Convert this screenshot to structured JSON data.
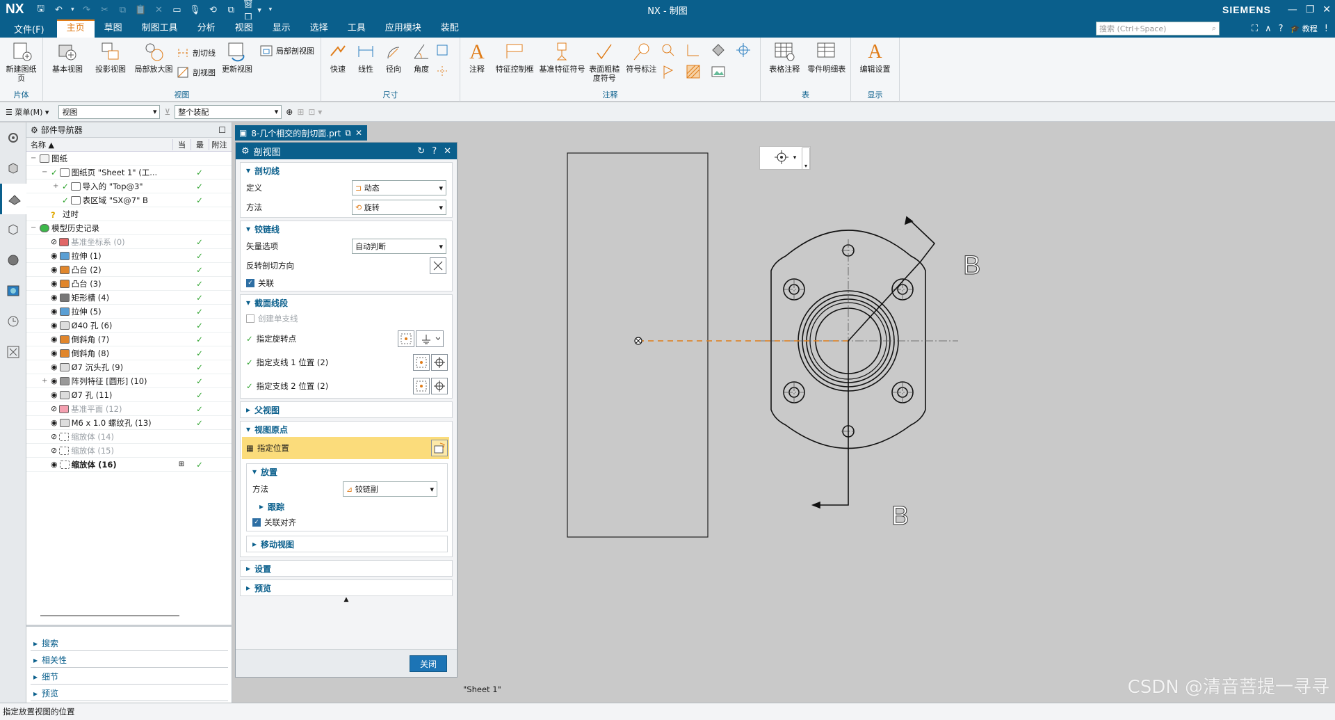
{
  "app": {
    "logo": "NX",
    "window_title": "NX - 制图",
    "brand": "SIEMENS",
    "window_menu": "窗口"
  },
  "menubar": {
    "file": "文件(F)",
    "tabs": [
      "主页",
      "草图",
      "制图工具",
      "分析",
      "视图",
      "显示",
      "选择",
      "工具",
      "应用模块",
      "装配"
    ],
    "active_tab": "主页",
    "search_placeholder": "搜索 (Ctrl+Space)",
    "help": "教程"
  },
  "ribbon": {
    "sheet_group": {
      "label": "片体",
      "new_sheet": "新建图纸页"
    },
    "view_group": {
      "label": "视图",
      "base_view": "基本视图",
      "projected_view": "投影视图",
      "detail_view": "局部放大图",
      "section_line": "剖切线",
      "section_view": "剖视图",
      "update_view": "更新视图",
      "break_out": "局部剖视图"
    },
    "dim_group": {
      "label": "尺寸",
      "rapid": "快速",
      "linear": "线性",
      "radial": "径向",
      "angular": "角度"
    },
    "annot_group": {
      "label": "注释",
      "note": "注释",
      "fcf": "特征控制框",
      "datum": "基准特征符号",
      "surface": "表面粗糙度符号",
      "symbol": "符号标注"
    },
    "table_group": {
      "label": "表",
      "table_note": "表格注释",
      "parts_list": "零件明细表"
    },
    "display_group": {
      "label": "显示",
      "edit_settings": "编辑设置"
    }
  },
  "toolbar2": {
    "menu": "菜单(M)",
    "filter": "视图",
    "scope": "整个装配"
  },
  "navigator": {
    "title": "部件导航器",
    "col_name": "名称",
    "col_current": "当",
    "col_latest": "最",
    "col_note": "附注",
    "rows": [
      {
        "indent": 0,
        "expander": "−",
        "label": "图纸",
        "check": false,
        "bold": false,
        "gray": false,
        "icon": "folder"
      },
      {
        "indent": 1,
        "expander": "−",
        "label": "图纸页 \"Sheet 1\" (工...",
        "check": true,
        "bold": false,
        "gray": false,
        "icon": "sheet"
      },
      {
        "indent": 2,
        "expander": "+",
        "label": "导入的 \"Top@3\"",
        "check": true,
        "bold": false,
        "gray": false,
        "icon": "view"
      },
      {
        "indent": 2,
        "expander": "",
        "label": "表区域 \"SX@7\" B",
        "check": true,
        "bold": false,
        "gray": false,
        "icon": "section"
      },
      {
        "indent": 1,
        "expander": "",
        "label": "过时",
        "check": false,
        "bold": false,
        "gray": false,
        "icon": "question"
      },
      {
        "indent": 0,
        "expander": "−",
        "label": "模型历史记录",
        "check": false,
        "bold": false,
        "gray": false,
        "icon": "history"
      },
      {
        "indent": 1,
        "expander": "",
        "label": "基准坐标系 (0)",
        "check": true,
        "bold": false,
        "gray": true,
        "icon": "csys"
      },
      {
        "indent": 1,
        "expander": "",
        "label": "拉伸 (1)",
        "check": true,
        "bold": false,
        "gray": false,
        "icon": "extrude"
      },
      {
        "indent": 1,
        "expander": "",
        "label": "凸台 (2)",
        "check": true,
        "bold": false,
        "gray": false,
        "icon": "boss"
      },
      {
        "indent": 1,
        "expander": "",
        "label": "凸台 (3)",
        "check": true,
        "bold": false,
        "gray": false,
        "icon": "boss"
      },
      {
        "indent": 1,
        "expander": "",
        "label": "矩形槽 (4)",
        "check": true,
        "bold": false,
        "gray": false,
        "icon": "slot"
      },
      {
        "indent": 1,
        "expander": "",
        "label": "拉伸 (5)",
        "check": true,
        "bold": false,
        "gray": false,
        "icon": "extrude"
      },
      {
        "indent": 1,
        "expander": "",
        "label": "Ø40 孔 (6)",
        "check": true,
        "bold": false,
        "gray": false,
        "icon": "hole"
      },
      {
        "indent": 1,
        "expander": "",
        "label": "倒斜角 (7)",
        "check": true,
        "bold": false,
        "gray": false,
        "icon": "chamfer"
      },
      {
        "indent": 1,
        "expander": "",
        "label": "倒斜角 (8)",
        "check": true,
        "bold": false,
        "gray": false,
        "icon": "chamfer"
      },
      {
        "indent": 1,
        "expander": "",
        "label": "Ø7 沉头孔 (9)",
        "check": true,
        "bold": false,
        "gray": false,
        "icon": "hole"
      },
      {
        "indent": 1,
        "expander": "+",
        "label": "阵列特征 [圆形] (10)",
        "check": true,
        "bold": false,
        "gray": false,
        "icon": "pattern"
      },
      {
        "indent": 1,
        "expander": "",
        "label": "Ø7 孔 (11)",
        "check": true,
        "bold": false,
        "gray": false,
        "icon": "hole"
      },
      {
        "indent": 1,
        "expander": "",
        "label": "基准平面 (12)",
        "check": true,
        "bold": false,
        "gray": true,
        "icon": "plane"
      },
      {
        "indent": 1,
        "expander": "",
        "label": "M6 x 1.0 螺纹孔 (13)",
        "check": true,
        "bold": false,
        "gray": false,
        "icon": "hole"
      },
      {
        "indent": 1,
        "expander": "",
        "label": "缩放体 (14)",
        "check": false,
        "bold": false,
        "gray": true,
        "icon": "scale"
      },
      {
        "indent": 1,
        "expander": "",
        "label": "缩放体 (15)",
        "check": false,
        "bold": false,
        "gray": true,
        "icon": "scale"
      },
      {
        "indent": 1,
        "expander": "",
        "label": "缩放体 (16)",
        "check": true,
        "bold": true,
        "gray": false,
        "icon": "scale"
      }
    ],
    "sections": [
      "搜索",
      "相关性",
      "细节",
      "预览"
    ]
  },
  "doctab": {
    "title": "8-几个相交的剖切面.prt"
  },
  "dialog": {
    "title": "剖视图",
    "sec_cutline": "剖切线",
    "define_label": "定义",
    "define_value": "动态",
    "method_label": "方法",
    "method_value": "旋转",
    "sec_hinge": "铰链线",
    "vector_label": "矢量选项",
    "vector_value": "自动判断",
    "reverse_label": "反转剖切方向",
    "assoc_label": "关联",
    "sec_segments": "截面线段",
    "single_branch": "创建单支线",
    "rot_point": "指定旋转点",
    "branch1": "指定支线 1 位置 (2)",
    "branch2": "指定支线 2 位置 (2)",
    "sec_parent": "父视图",
    "sec_origin": "视图原点",
    "specify_loc": "指定位置",
    "sec_place": "放置",
    "place_method_label": "方法",
    "place_method_value": "铰链副",
    "track": "跟踪",
    "assoc_align": "关联对齐",
    "sec_move": "移动视图",
    "sec_settings": "设置",
    "sec_preview": "预览",
    "close": "关闭"
  },
  "canvas": {
    "label_b_top": "B",
    "label_b_bottom": "B",
    "sheet_name": "\"Sheet 1\""
  },
  "statusbar": {
    "text": "指定放置视图的位置"
  },
  "watermark": "CSDN @清音菩提一寻寻"
}
